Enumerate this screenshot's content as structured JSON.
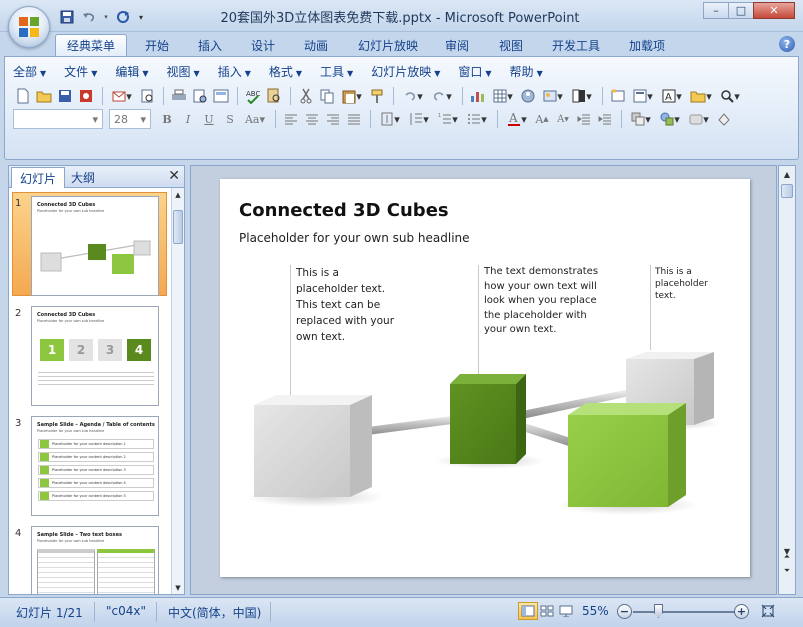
{
  "window": {
    "title": "20套国外3D立体图表免费下载.pptx - Microsoft PowerPoint",
    "controls": [
      "–",
      "□",
      "✕"
    ]
  },
  "ribbon_tabs": [
    "经典菜单",
    "开始",
    "插入",
    "设计",
    "动画",
    "幻灯片放映",
    "审阅",
    "视图",
    "开发工具",
    "加载项"
  ],
  "active_tab": "经典菜单",
  "help_label": "?",
  "menus": [
    "全部",
    "文件",
    "编辑",
    "视图",
    "插入",
    "格式",
    "工具",
    "幻灯片放映",
    "窗口",
    "帮助"
  ],
  "font_size_value": "28",
  "slide_pane": {
    "tabs": [
      "幻灯片",
      "大纲"
    ],
    "close_label": "✕",
    "thumbnails": [
      {
        "num": "1",
        "title": "Connected 3D Cubes",
        "sub": "Placeholder for your own sub headline"
      },
      {
        "num": "2",
        "title": "Connected 3D Cubes",
        "sub": "Placeholder for your own sub headline",
        "digits": [
          "1",
          "2",
          "3",
          "4"
        ]
      },
      {
        "num": "3",
        "title": "Sample Slide – Agenda / Table of contents",
        "sub": "Placeholder for your own sub headline",
        "rows": [
          "Placeholder for your content description 1",
          "Placeholder for your content description 2",
          "Placeholder for your content description 3",
          "Placeholder for your content description 4",
          "Placeholder for your content description 5"
        ]
      },
      {
        "num": "4",
        "title": "Sample Slide – Two text boxes",
        "sub": "Placeholder for your own sub headline"
      }
    ]
  },
  "slide": {
    "title": "Connected 3D Cubes",
    "subtitle": "Placeholder for your own sub headline",
    "text1": [
      "This is a",
      "placeholder text.",
      "This text can be",
      "replaced with your",
      "own text."
    ],
    "text2": [
      "The text demonstrates",
      "how your own text will",
      "look when you replace",
      "the placeholder with",
      "your own text."
    ],
    "text3": [
      "This is a",
      "placeholder",
      "text."
    ]
  },
  "colors": {
    "green_dark": "#5a8a1e",
    "green_light": "#8dc63f",
    "gray_cube": "#d4d4d4"
  },
  "statusbar": {
    "slide_info": "幻灯片 1/21",
    "theme": "\"c04x\"",
    "language": "中文(简体，中国)",
    "zoom": "55%",
    "zoom_minus": "−",
    "zoom_plus": "+"
  }
}
